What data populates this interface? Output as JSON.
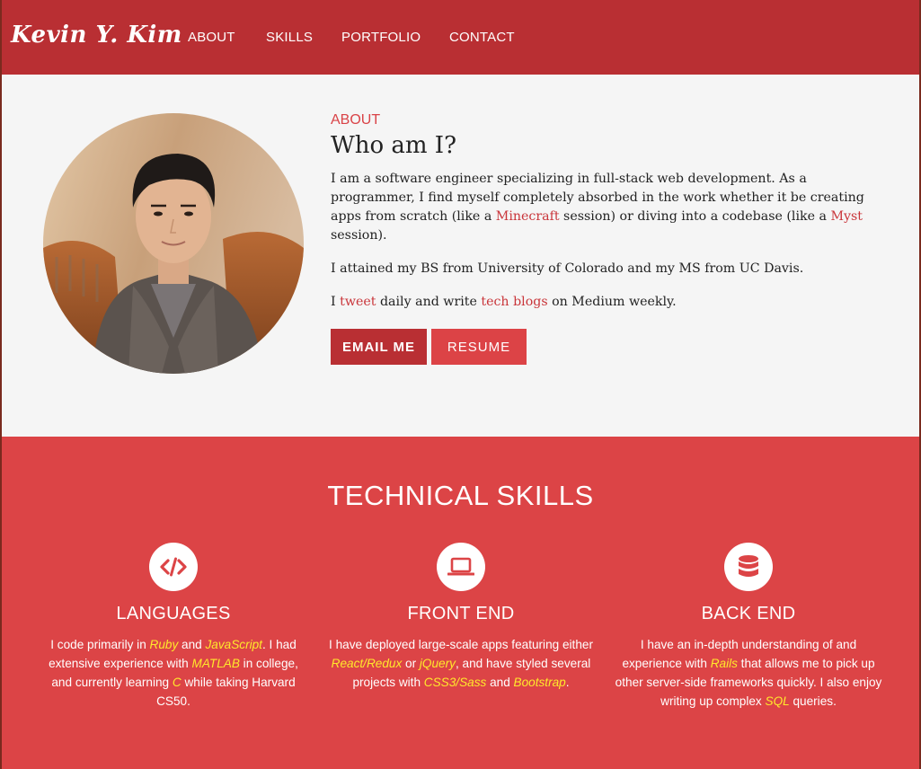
{
  "nav": {
    "brand": "Kevin Y. Kim",
    "items": [
      "ABOUT",
      "SKILLS",
      "PORTFOLIO",
      "CONTACT"
    ]
  },
  "about": {
    "eyebrow": "ABOUT",
    "title": "Who am I?",
    "p1": {
      "a": "I am a software engineer specializing in full-stack web development. As a programmer, I find myself completely absorbed in the work whether it be creating apps from scratch (like a ",
      "link1": "Minecraft",
      "b": " session) or diving into a codebase (like a ",
      "link2": "Myst",
      "c": " session)."
    },
    "p2": "I attained my BS from University of Colorado and my MS from UC Davis.",
    "p3": {
      "a": "I ",
      "link1": "tweet",
      "b": " daily and write ",
      "link2": "tech blogs",
      "c": " on Medium weekly."
    },
    "email_button": "EMAIL ME",
    "resume_button": "RESUME"
  },
  "skills": {
    "title": "TECHNICAL SKILLS",
    "languages": {
      "title": "LANGUAGES",
      "t1": "I code primarily in ",
      "h1": "Ruby",
      "t2": " and ",
      "h2": "JavaScript",
      "t3": ". I had extensive experience with ",
      "h3": "MATLAB",
      "t4": " in college, and currently learning ",
      "h4": "C",
      "t5": " while taking Harvard CS50."
    },
    "frontend": {
      "title": "FRONT END",
      "t1": "I have deployed large-scale apps featuring either ",
      "h1": "React/Redux",
      "t2": " or ",
      "h2": "jQuery",
      "t3": ", and have styled several projects with ",
      "h3": "CSS3/Sass",
      "t4": " and ",
      "h4": "Bootstrap",
      "t5": "."
    },
    "backend": {
      "title": "BACK END",
      "t1": "I have an in-depth understanding of and experience with ",
      "h1": "Rails",
      "t2": " that allows me to pick up other server-side frameworks quickly. I also enjoy writing up complex ",
      "h2": "SQL",
      "t3": " queries."
    }
  },
  "colors": {
    "nav_bg": "#b92f33",
    "skills_bg": "#dc4446",
    "link": "#c9353a",
    "highlight": "#ffe92b"
  },
  "icons": [
    "code-icon",
    "laptop-icon",
    "database-icon"
  ]
}
